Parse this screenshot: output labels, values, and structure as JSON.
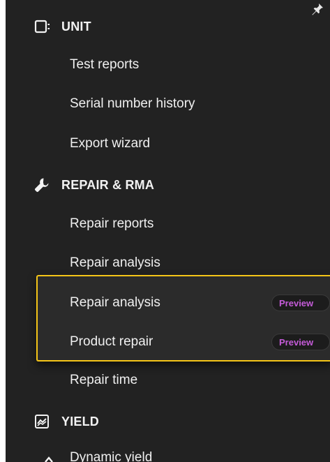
{
  "sections": {
    "unit": {
      "label": "UNIT",
      "icon": "unit-icon",
      "items": [
        "Test reports",
        "Serial number history",
        "Export wizard"
      ]
    },
    "repair": {
      "label": "REPAIR & RMA",
      "icon": "wrench-icon",
      "items": [
        "Repair reports",
        "Repair analysis"
      ],
      "preview_items": [
        {
          "label": "Repair analysis",
          "badge": "Preview"
        },
        {
          "label": "Product repair",
          "badge": "Preview"
        }
      ],
      "after_items": [
        "Repair time"
      ]
    },
    "yield": {
      "label": "YIELD",
      "icon": "yield-chart-icon",
      "items": [
        "Dynamic yield"
      ]
    }
  },
  "colors": {
    "sidebar_bg": "#222222",
    "text": "#f0f0f0",
    "highlight_border": "#f5c518",
    "preview_text": "#c45bd8"
  }
}
